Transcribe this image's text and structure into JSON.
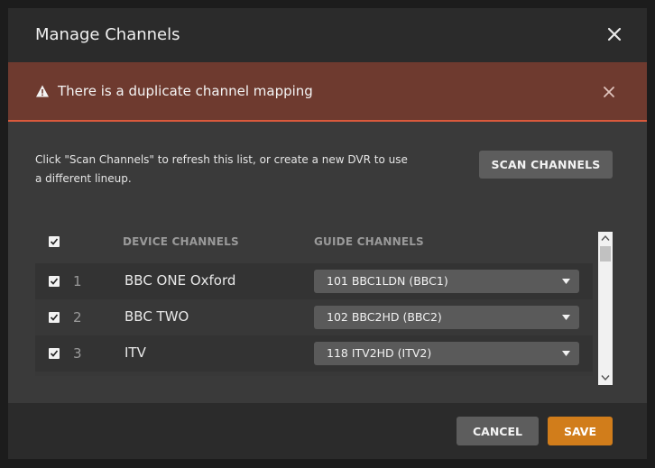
{
  "modal": {
    "title": "Manage Channels",
    "close_icon": "close-icon"
  },
  "alert": {
    "message": "There is a duplicate channel mapping",
    "icon": "warning-icon",
    "close_icon": "close-icon",
    "color": "#6e3a2f",
    "border_color": "#d9593c"
  },
  "body": {
    "description": "Click \"Scan Channels\" to refresh this list, or create a new DVR to use a different lineup.",
    "scan_label": "SCAN CHANNELS"
  },
  "table": {
    "columns": {
      "device": "DEVICE CHANNELS",
      "guide": "GUIDE CHANNELS"
    },
    "select_all_checked": true,
    "rows": [
      {
        "number": "1",
        "name": "BBC ONE Oxford",
        "guide": "101 BBC1LDN (BBC1)",
        "checked": true
      },
      {
        "number": "2",
        "name": "BBC TWO",
        "guide": "102 BBC2HD (BBC2)",
        "checked": true
      },
      {
        "number": "3",
        "name": "ITV",
        "guide": "118 ITV2HD (ITV2)",
        "checked": true
      }
    ]
  },
  "footer": {
    "cancel_label": "CANCEL",
    "save_label": "SAVE",
    "accent_color": "#d17d1b"
  }
}
